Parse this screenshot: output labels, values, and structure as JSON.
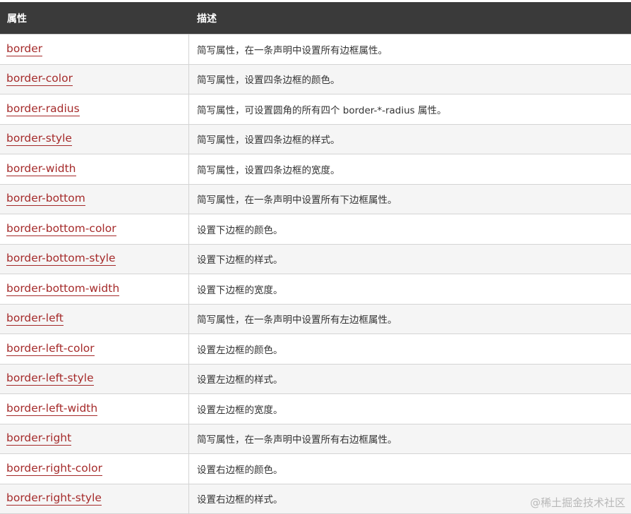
{
  "header": {
    "col_property": "属性",
    "col_description": "描述"
  },
  "rows": [
    {
      "property": "border",
      "description": "简写属性，在一条声明中设置所有边框属性。"
    },
    {
      "property": "border-color",
      "description": "简写属性，设置四条边框的颜色。"
    },
    {
      "property": "border-radius",
      "description": "简写属性，可设置圆角的所有四个 border-*-radius 属性。"
    },
    {
      "property": "border-style",
      "description": "简写属性，设置四条边框的样式。"
    },
    {
      "property": "border-width",
      "description": "简写属性，设置四条边框的宽度。"
    },
    {
      "property": "border-bottom",
      "description": "简写属性，在一条声明中设置所有下边框属性。"
    },
    {
      "property": "border-bottom-color",
      "description": "设置下边框的颜色。"
    },
    {
      "property": "border-bottom-style",
      "description": "设置下边框的样式。"
    },
    {
      "property": "border-bottom-width",
      "description": "设置下边框的宽度。"
    },
    {
      "property": "border-left",
      "description": "简写属性，在一条声明中设置所有左边框属性。"
    },
    {
      "property": "border-left-color",
      "description": "设置左边框的颜色。"
    },
    {
      "property": "border-left-style",
      "description": "设置左边框的样式。"
    },
    {
      "property": "border-left-width",
      "description": "设置左边框的宽度。"
    },
    {
      "property": "border-right",
      "description": "简写属性，在一条声明中设置所有右边框属性。"
    },
    {
      "property": "border-right-color",
      "description": "设置右边框的颜色。"
    },
    {
      "property": "border-right-style",
      "description": "设置右边框的样式。"
    }
  ],
  "watermark": "@稀土掘金技术社区",
  "colors": {
    "header_bg": "#3a3a3a",
    "link": "#a52a2a",
    "row_alt": "#f5f5f5"
  }
}
